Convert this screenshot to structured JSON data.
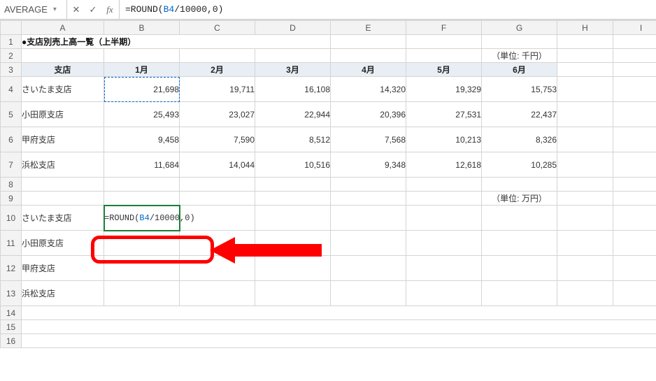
{
  "name_box": "AVERAGE",
  "formula_bar": {
    "prefix": "=ROUND(",
    "ref": "B4",
    "suffix": "/10000,0)"
  },
  "columns": [
    "A",
    "B",
    "C",
    "D",
    "E",
    "F",
    "G",
    "H",
    "I"
  ],
  "row_labels": [
    "1",
    "2",
    "3",
    "4",
    "5",
    "6",
    "7",
    "8",
    "9",
    "10",
    "11",
    "12",
    "13",
    "14",
    "15",
    "16"
  ],
  "title": "●支店別売上高一覧（上半期）",
  "unit_label_top": "（単位: 千円）",
  "unit_label_bottom": "（単位: 万円）",
  "headers": [
    "支店",
    "1月",
    "2月",
    "3月",
    "4月",
    "5月",
    "6月"
  ],
  "data_rows": [
    {
      "branch": "さいたま支店",
      "vals": [
        "21,698",
        "19,711",
        "16,108",
        "14,320",
        "19,329",
        "15,753"
      ]
    },
    {
      "branch": "小田原支店",
      "vals": [
        "25,493",
        "23,027",
        "22,944",
        "20,396",
        "27,531",
        "22,437"
      ]
    },
    {
      "branch": "甲府支店",
      "vals": [
        "9,458",
        "7,590",
        "8,512",
        "7,568",
        "10,213",
        "8,326"
      ]
    },
    {
      "branch": "浜松支店",
      "vals": [
        "11,684",
        "14,044",
        "10,516",
        "9,348",
        "12,618",
        "10,285"
      ]
    }
  ],
  "lower_branches": [
    "さいたま支店",
    "小田原支店",
    "甲府支店",
    "浜松支店"
  ],
  "edit_cell": {
    "prefix": "=ROUND(",
    "ref": "B4",
    "suffix": "/10000,0)"
  },
  "icons": {
    "cancel": "✕",
    "accept": "✓",
    "fx": "fx",
    "dropdown": "▾"
  },
  "chart_data": {
    "type": "table",
    "title": "支店別売上高一覧（上半期）",
    "unit": "千円",
    "columns": [
      "支店",
      "1月",
      "2月",
      "3月",
      "4月",
      "5月",
      "6月"
    ],
    "rows": [
      [
        "さいたま支店",
        21698,
        19711,
        16108,
        14320,
        19329,
        15753
      ],
      [
        "小田原支店",
        25493,
        23027,
        22944,
        20396,
        27531,
        22437
      ],
      [
        "甲府支店",
        9458,
        7590,
        8512,
        7568,
        10213,
        8326
      ],
      [
        "浜松支店",
        11684,
        14044,
        10516,
        9348,
        12618,
        10285
      ]
    ]
  }
}
